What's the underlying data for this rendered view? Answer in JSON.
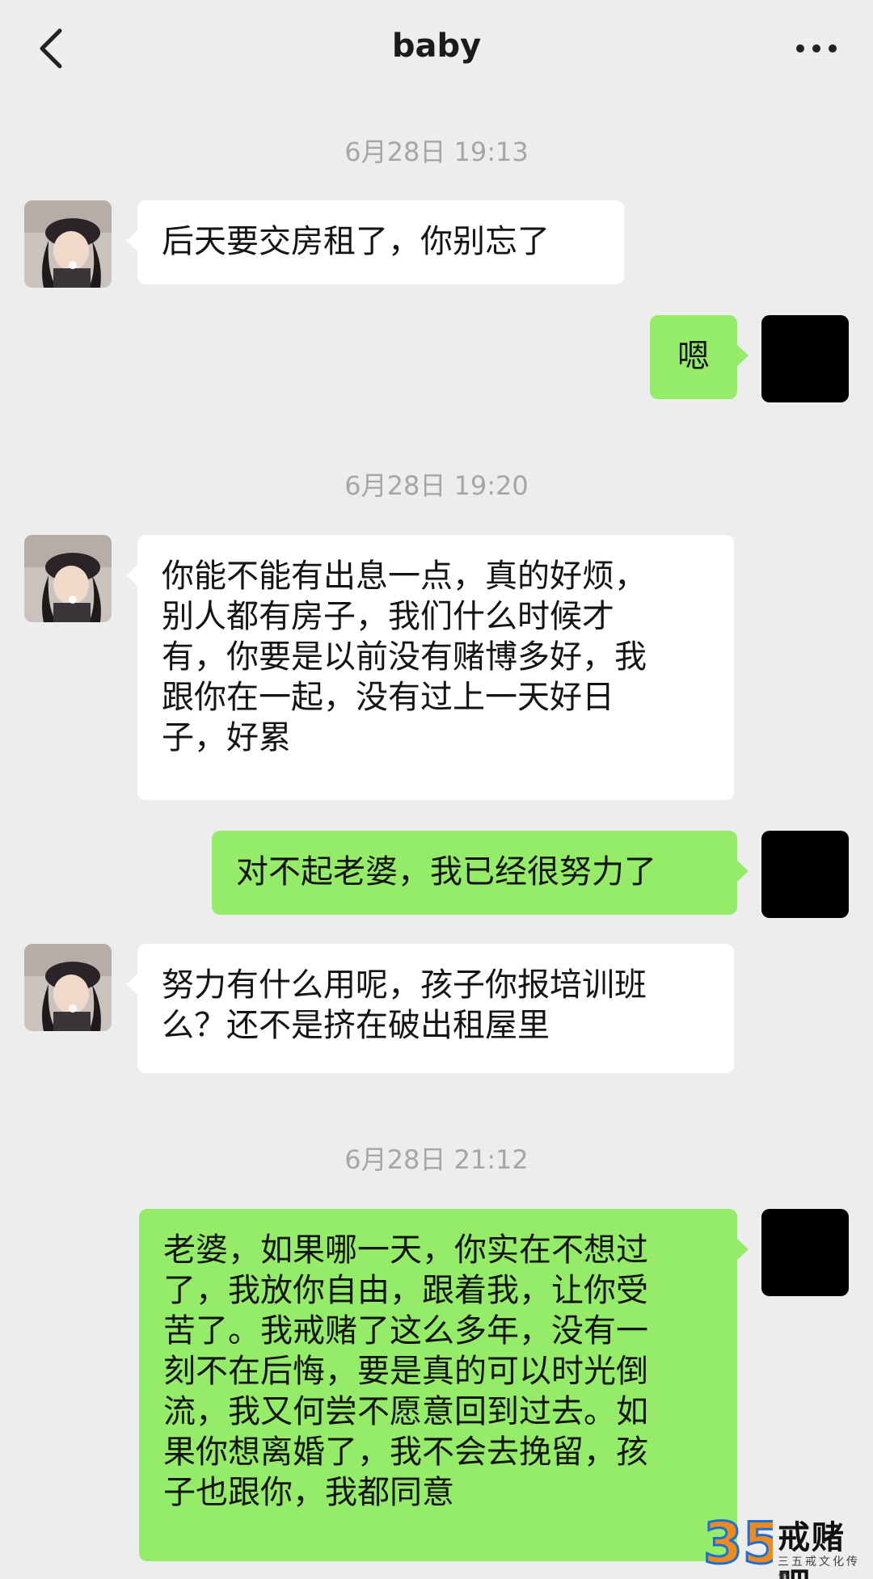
{
  "header": {
    "title": "baby"
  },
  "messages": [
    {
      "kind": "timestamp",
      "text": "6月28日 19:13"
    },
    {
      "kind": "incoming",
      "lines": [
        "后天要交房租了，你别忘了"
      ]
    },
    {
      "kind": "outgoing",
      "lines": [
        "嗯"
      ]
    },
    {
      "kind": "timestamp",
      "text": "6月28日 19:20"
    },
    {
      "kind": "incoming",
      "lines": [
        "你能不能有出息一点，真的好烦，",
        "别人都有房子，我们什么时候才",
        "有，你要是以前没有赌博多好，我",
        "跟你在一起，没有过上一天好日",
        "子，好累"
      ]
    },
    {
      "kind": "outgoing",
      "lines": [
        "对不起老婆，我已经很努力了"
      ]
    },
    {
      "kind": "incoming",
      "lines": [
        "努力有什么用呢，孩子你报培训班",
        "么？还不是挤在破出租屋里"
      ]
    },
    {
      "kind": "timestamp",
      "text": "6月28日 21:12"
    },
    {
      "kind": "outgoing",
      "lines": [
        "老婆，如果哪一天，你实在不想过",
        "了，我放你自由，跟着我，让你受",
        "苦了。我戒赌了这么多年，没有一",
        "刻不在后悔，要是真的可以时光倒",
        "流，我又何尝不愿意回到过去。如",
        "果你想离婚了，我不会去挽留，孩",
        "子也跟你，我都同意"
      ]
    }
  ],
  "watermark": {
    "number": "35",
    "title": "戒赌吧",
    "subtitle": "三五戒文化传承"
  },
  "colors": {
    "background": "#ededed",
    "incoming_bubble": "#ffffff",
    "outgoing_bubble": "#95ec69",
    "timestamp_text": "#a6a6a6"
  }
}
